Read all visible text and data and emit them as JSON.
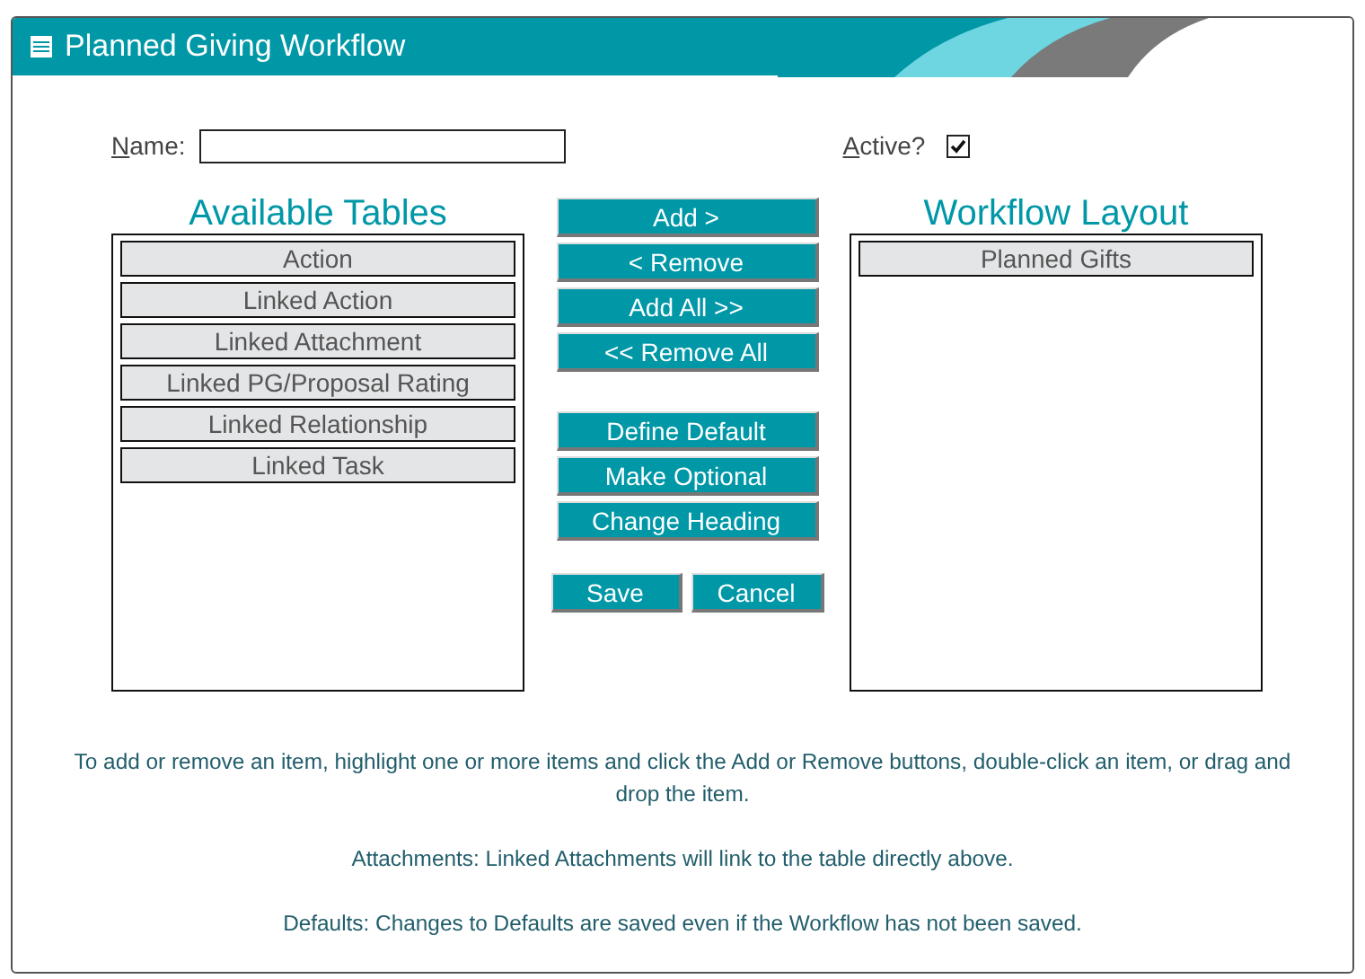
{
  "window": {
    "title": "Planned Giving Workflow"
  },
  "name_field": {
    "label": "Name:",
    "mnemonic": true
  },
  "active": {
    "label": "Active?",
    "mnemonic": true,
    "checked": true
  },
  "available_tables": {
    "heading": "Available Tables",
    "items": [
      {
        "label": "Action",
        "selected": false
      },
      {
        "label": "Linked Action",
        "selected": false
      },
      {
        "label": "Linked Attachment",
        "selected": false
      },
      {
        "label": "Linked PG/Proposal Rating",
        "selected": false
      },
      {
        "label": "Linked Relationship",
        "selected": false
      },
      {
        "label": "Linked Task",
        "selected": false
      }
    ]
  },
  "move_buttons": [
    "Add >",
    "< Remove",
    "Add All >>",
    "<< Remove All"
  ],
  "option_buttons": [
    "Define Default",
    "Make Optional",
    "Change Heading"
  ],
  "action_buttons": [
    "Save",
    "Cancel"
  ],
  "workflow_layout": {
    "heading": "Workflow Layout",
    "items": [
      {
        "label": "Planned Gifts",
        "selected": false
      }
    ]
  },
  "notes": [
    "To add or remove an item, highlight one or more items and click the Add or Remove buttons, double-click an item, or drag and drop the item.",
    "Attachments: Linked Attachments will link to the table directly above.",
    "Defaults: Changes to Defaults are saved even if the Workflow has not been saved."
  ]
}
